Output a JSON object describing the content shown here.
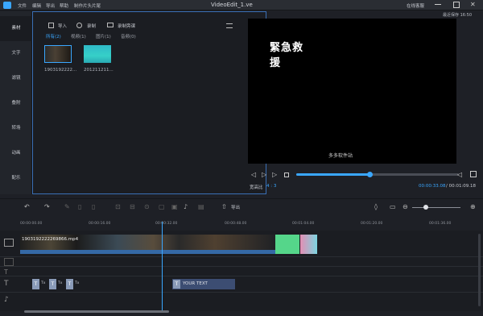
{
  "titlebar": {
    "menus": [
      "文件",
      "编辑",
      "导出",
      "帮助",
      "制作片头片尾"
    ],
    "title": "VideoEdit_1.ve",
    "right_label": "在线客服",
    "save_time": "最近保存 16:50"
  },
  "sidebar": {
    "items": [
      "素材",
      "文字",
      "滤镜",
      "叠附",
      "转场",
      "动画",
      "配乐"
    ],
    "active": "素材"
  },
  "media": {
    "import_label": "导入",
    "record_label": "录制",
    "screen_record_label": "录制旁课",
    "filters": [
      "所有(2)",
      "视频(1)",
      "图片(1)",
      "音频(0)"
    ],
    "active_filter": "所有(2)",
    "items": [
      {
        "caption": "1903192222...",
        "icon": "video-thumb"
      },
      {
        "caption": "201211211...",
        "icon": "image-thumb"
      }
    ]
  },
  "preview": {
    "title_text": "緊急救援",
    "subtitle": "多多软件站",
    "progress": 0.45,
    "ratio_label": "宽高比",
    "ratio_value": "4 : 3",
    "current_time": "00:00:33.08",
    "total_time": "/ 00:01:09.18"
  },
  "timeline": {
    "export_label": "导出",
    "ruler": [
      "00:00:00.00",
      "00:00:16.00",
      "00:00:32.00",
      "00:00:48.00",
      "00:01:04.00",
      "00:01:20.00",
      "00:01:36.00"
    ],
    "video_clip_label": "1903192222269866.mp4",
    "text_clip_label": "YOUR TEXT",
    "small_text_labels": [
      "Tx",
      "Tx",
      "Tx",
      "Tx"
    ]
  },
  "colors": {
    "accent": "#3aa7ff",
    "background": "#1e2026"
  }
}
